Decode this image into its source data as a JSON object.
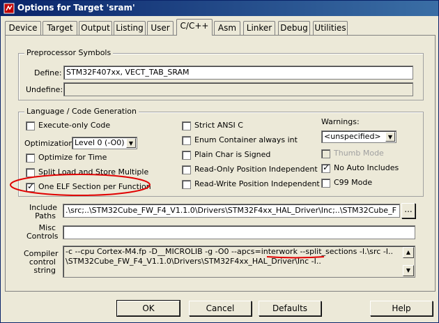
{
  "window": {
    "title": "Options for Target 'sram'"
  },
  "tabs": [
    {
      "label": "Device"
    },
    {
      "label": "Target"
    },
    {
      "label": "Output"
    },
    {
      "label": "Listing"
    },
    {
      "label": "User"
    },
    {
      "label": "C/C++"
    },
    {
      "label": "Asm"
    },
    {
      "label": "Linker"
    },
    {
      "label": "Debug"
    },
    {
      "label": "Utilities"
    }
  ],
  "preprocessor": {
    "group_label": "Preprocessor Symbols",
    "define_label": "Define:",
    "define_value": "STM32F407xx, VECT_TAB_SRAM",
    "undefine_label": "Undefine:",
    "undefine_value": ""
  },
  "language": {
    "group_label": "Language / Code Generation",
    "execute_only": {
      "label": "Execute-only Code",
      "checked": false
    },
    "optimization_label": "Optimization:",
    "optimization_value": "Level 0 (-O0)",
    "optimize_time": {
      "label": "Optimize for Time",
      "checked": false
    },
    "split_load": {
      "label": "Split Load and Store Multiple",
      "checked": false
    },
    "one_elf": {
      "label": "One ELF Section per Function",
      "checked": true
    },
    "strict_ansi": {
      "label": "Strict ANSI C",
      "checked": false
    },
    "enum_container": {
      "label": "Enum Container always int",
      "checked": false
    },
    "plain_char": {
      "label": "Plain Char is Signed",
      "checked": false
    },
    "ro_pos_indep": {
      "label": "Read-Only Position Independent",
      "checked": false
    },
    "rw_pos_indep": {
      "label": "Read-Write Position Independent",
      "checked": false
    },
    "warnings_label": "Warnings:",
    "warnings_value": "<unspecified>",
    "thumb_mode": {
      "label": "Thumb Mode",
      "checked": false,
      "disabled": true
    },
    "no_auto_includes": {
      "label": "No Auto Includes",
      "checked": true
    },
    "c99_mode": {
      "label": "C99 Mode",
      "checked": false
    }
  },
  "include_paths": {
    "label_line1": "Include",
    "label_line2": "Paths",
    "value": ".\\src;..\\STM32Cube_FW_F4_V1.1.0\\Drivers\\STM32F4xx_HAL_Driver\\Inc;..\\STM32Cube_F",
    "browse_label": "..."
  },
  "misc_controls": {
    "label_line1": "Misc",
    "label_line2": "Controls",
    "value": ""
  },
  "compiler_control": {
    "label_line1": "Compiler",
    "label_line2": "control",
    "label_line3": "string",
    "line1": "-c --cpu Cortex-M4.fp -D__MICROLIB -g -O0 --apcs=interwork --split_sections -I.\\src -I..",
    "line2": "\\STM32Cube_FW_F4_V1.1.0\\Drivers\\STM32F4xx_HAL_Driver\\Inc -I.."
  },
  "buttons": {
    "ok": "OK",
    "cancel": "Cancel",
    "defaults": "Defaults",
    "help": "Help"
  },
  "colors": {
    "title_start": "#0a246a",
    "title_end": "#3a6ea5",
    "annotation_red": "#e00000",
    "dialog_bg": "#ece9d8"
  }
}
